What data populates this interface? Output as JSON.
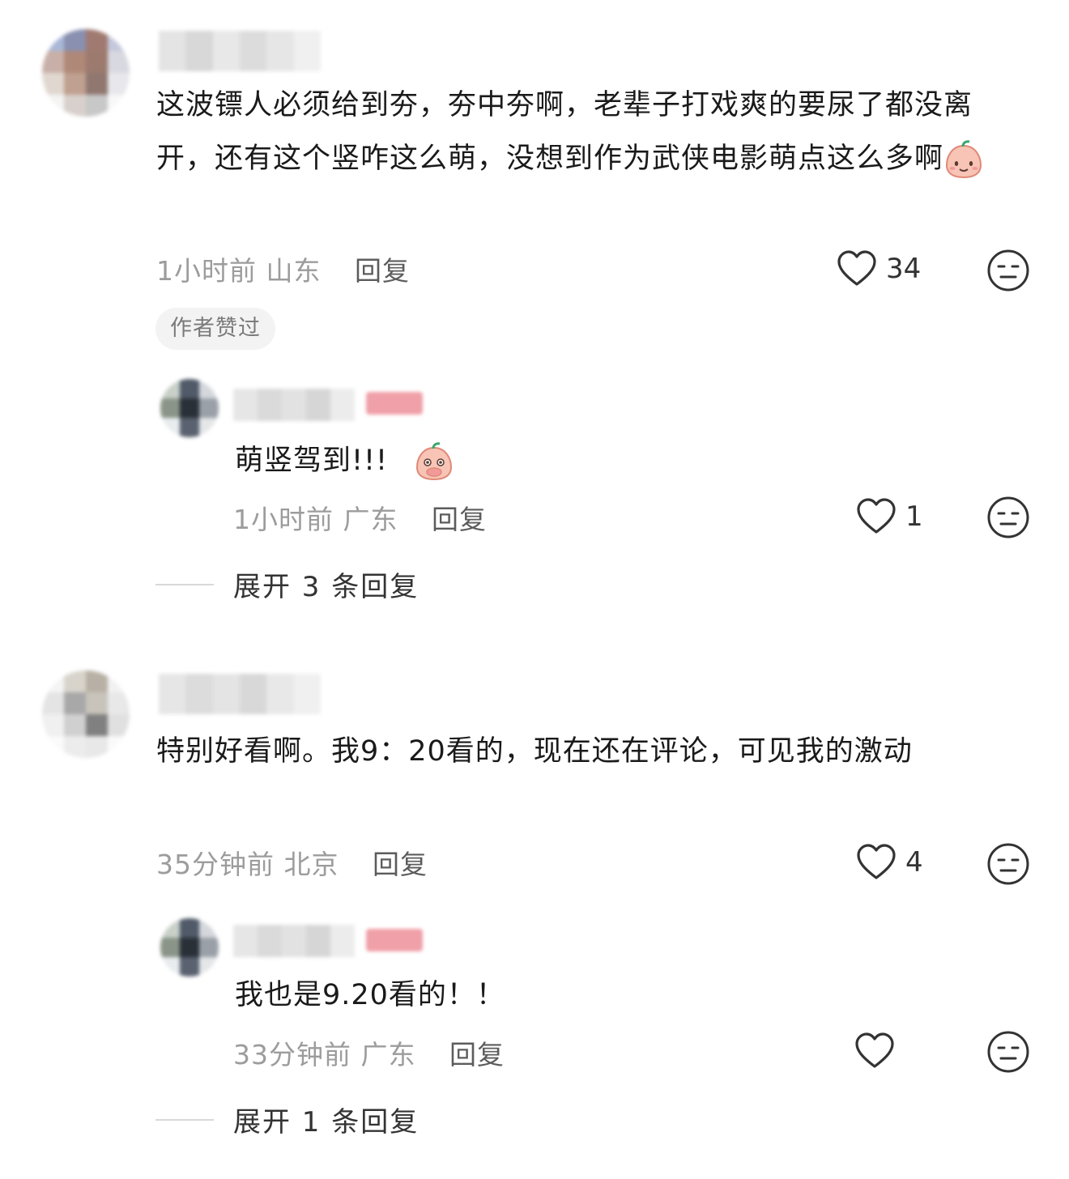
{
  "comments": [
    {
      "text": "这波镖人必须给到夯，夯中夯啊，老辈子打戏爽的要尿了都没离开，还有这个竖咋这么萌，没想到作为武侠电影萌点这么多啊",
      "time": "1小时前",
      "location": "山东",
      "reply_label": "回复",
      "likes": "34",
      "badge": "作者赞过",
      "reply": {
        "text": "萌竖驾到!!!",
        "time": "1小时前",
        "location": "广东",
        "reply_label": "回复",
        "likes": "1"
      },
      "expand_label": "展开 3 条回复"
    },
    {
      "text": "特别好看啊。我9：20看的，现在还在评论，可见我的激动",
      "time": "35分钟前",
      "location": "北京",
      "reply_label": "回复",
      "likes": "4",
      "reply": {
        "text": "我也是9.20看的！！",
        "time": "33分钟前",
        "location": "广东",
        "reply_label": "回复",
        "likes": ""
      },
      "expand_label": "展开 1 条回复"
    }
  ],
  "icons": {
    "like": "heart-outline-icon",
    "dislike": "meh-face-icon",
    "emoji": "peach-face-emoji"
  },
  "colors": {
    "text": "#1a1a1a",
    "meta": "#9c9c9c",
    "badge_bg": "#f3f3f3",
    "author_tag": "#f0a0a8"
  }
}
